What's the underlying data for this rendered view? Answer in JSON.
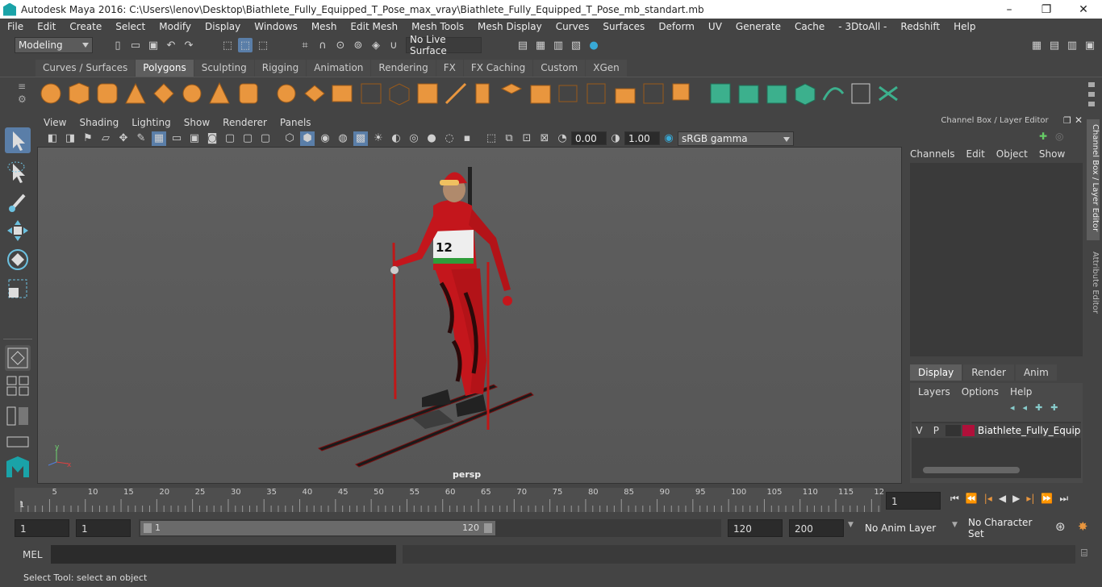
{
  "window": {
    "title": "Autodesk Maya 2016: C:\\Users\\lenov\\Desktop\\Biathlete_Fully_Equipped_T_Pose_max_vray\\Biathlete_Fully_Equipped_T_Pose_mb_standart.mb",
    "min": "–",
    "max": "❐",
    "close": "✕"
  },
  "menu": [
    "File",
    "Edit",
    "Create",
    "Select",
    "Modify",
    "Display",
    "Windows",
    "Mesh",
    "Edit Mesh",
    "Mesh Tools",
    "Mesh Display",
    "Curves",
    "Surfaces",
    "Deform",
    "UV",
    "Generate",
    "Cache",
    "- 3DtoAll -",
    "Redshift",
    "Help"
  ],
  "status": {
    "mode": "Modeling",
    "live_surface": "No Live Surface"
  },
  "shelf_tabs": [
    "Curves / Surfaces",
    "Polygons",
    "Sculpting",
    "Rigging",
    "Animation",
    "Rendering",
    "FX",
    "FX Caching",
    "Custom",
    "XGen"
  ],
  "active_shelf": "Polygons",
  "viewport_menu": [
    "View",
    "Shading",
    "Lighting",
    "Show",
    "Renderer",
    "Panels"
  ],
  "viewport_tools": {
    "exposure": "0.00",
    "gamma": "1.00",
    "color_space": "sRGB gamma"
  },
  "viewport": {
    "camera_label": "persp",
    "bib_number": "12"
  },
  "channel_box": {
    "title": "Channel Box / Layer Editor",
    "menu": [
      "Channels",
      "Edit",
      "Object",
      "Show"
    ]
  },
  "layer_editor": {
    "tabs": [
      "Display",
      "Render",
      "Anim"
    ],
    "active_tab": "Display",
    "menu": [
      "Layers",
      "Options",
      "Help"
    ],
    "layer": {
      "v": "V",
      "p": "P",
      "name": "Biathlete_Fully_Equipp",
      "color": "#b0103a"
    }
  },
  "side_tabs": {
    "channel": "Channel Box / Layer Editor",
    "attr": "Attribute Editor"
  },
  "timeline": {
    "ticks": [
      "5",
      "10",
      "15",
      "20",
      "25",
      "30",
      "35",
      "40",
      "45",
      "50",
      "55",
      "60",
      "65",
      "70",
      "75",
      "80",
      "85",
      "90",
      "95",
      "100",
      "105",
      "110",
      "115",
      "12"
    ],
    "current_frame_label": "1",
    "current_frame": "1"
  },
  "range": {
    "start": "1",
    "start2": "1",
    "slider_start": "1",
    "slider_end": "120",
    "end": "120",
    "end2": "200",
    "anim_layer": "No Anim Layer",
    "char_set": "No Character Set"
  },
  "mel": {
    "label": "MEL"
  },
  "help_line": "Select Tool: select an object"
}
